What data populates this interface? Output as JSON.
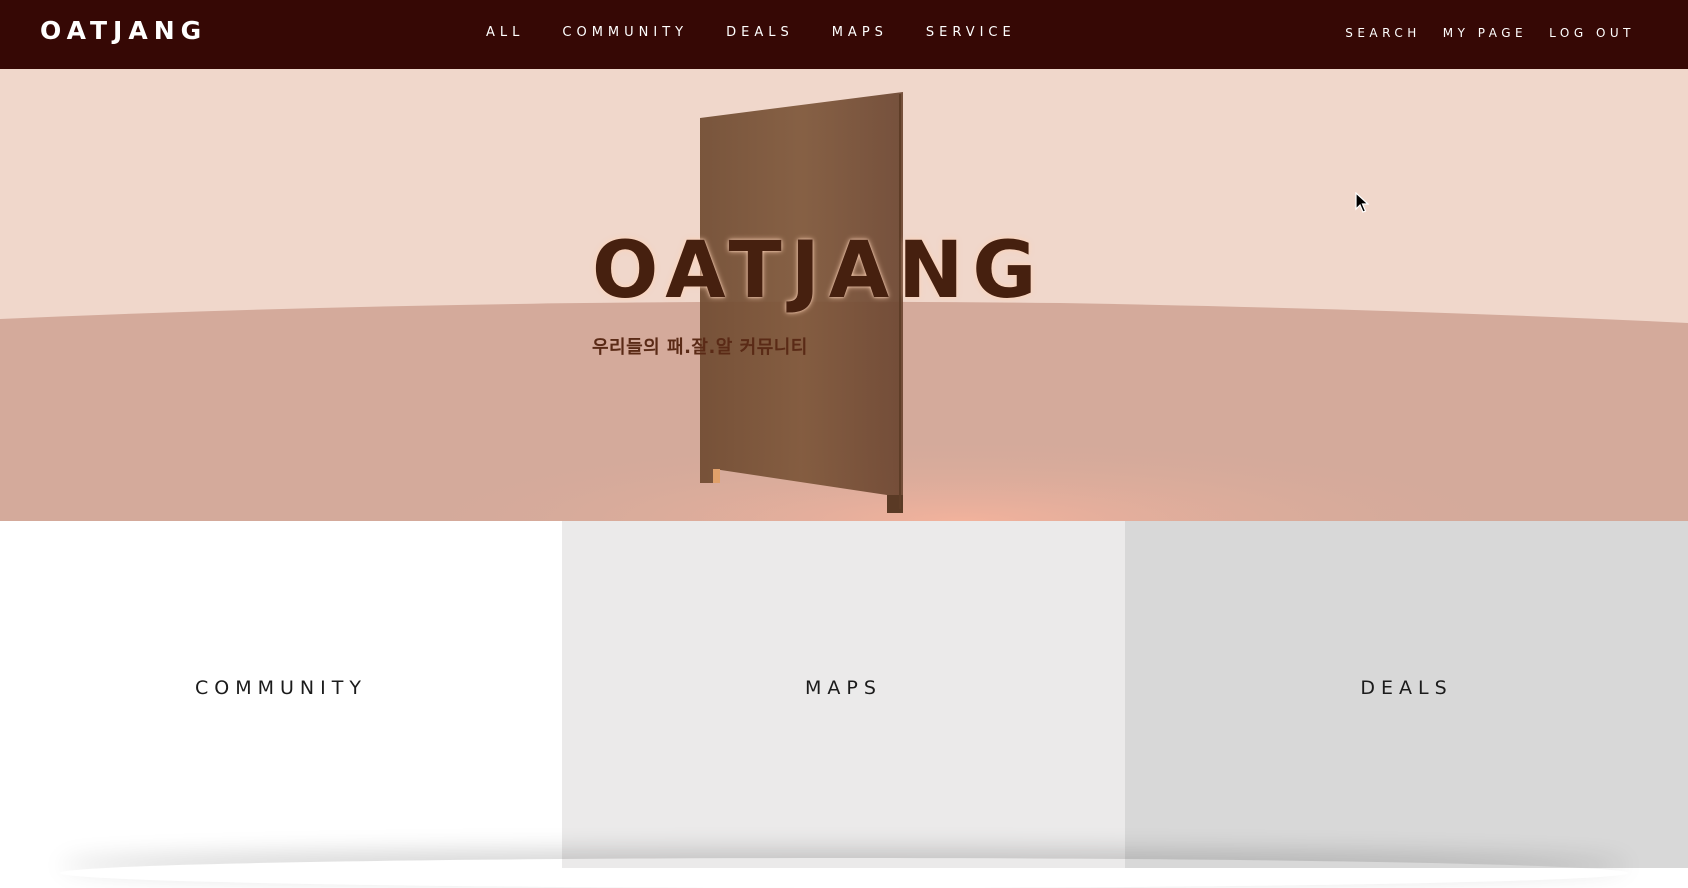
{
  "nav": {
    "logo": "OATJANG",
    "menu": [
      "ALL",
      "COMMUNITY",
      "DEALS",
      "MAPS",
      "SERVICE"
    ],
    "right": [
      "SEARCH",
      "MY PAGE",
      "LOG OUT"
    ]
  },
  "hero": {
    "title": "OATJANG",
    "subtitle": "우리들의 패.잘.알 커뮤니티"
  },
  "panels": [
    "COMMUNITY",
    "MAPS",
    "DEALS"
  ],
  "colors": {
    "nav_bg": "#360805",
    "hero_sky": "#f0d7cb",
    "hero_floor": "#d4aa9b",
    "title": "#46200f",
    "door": "#7a5438"
  }
}
